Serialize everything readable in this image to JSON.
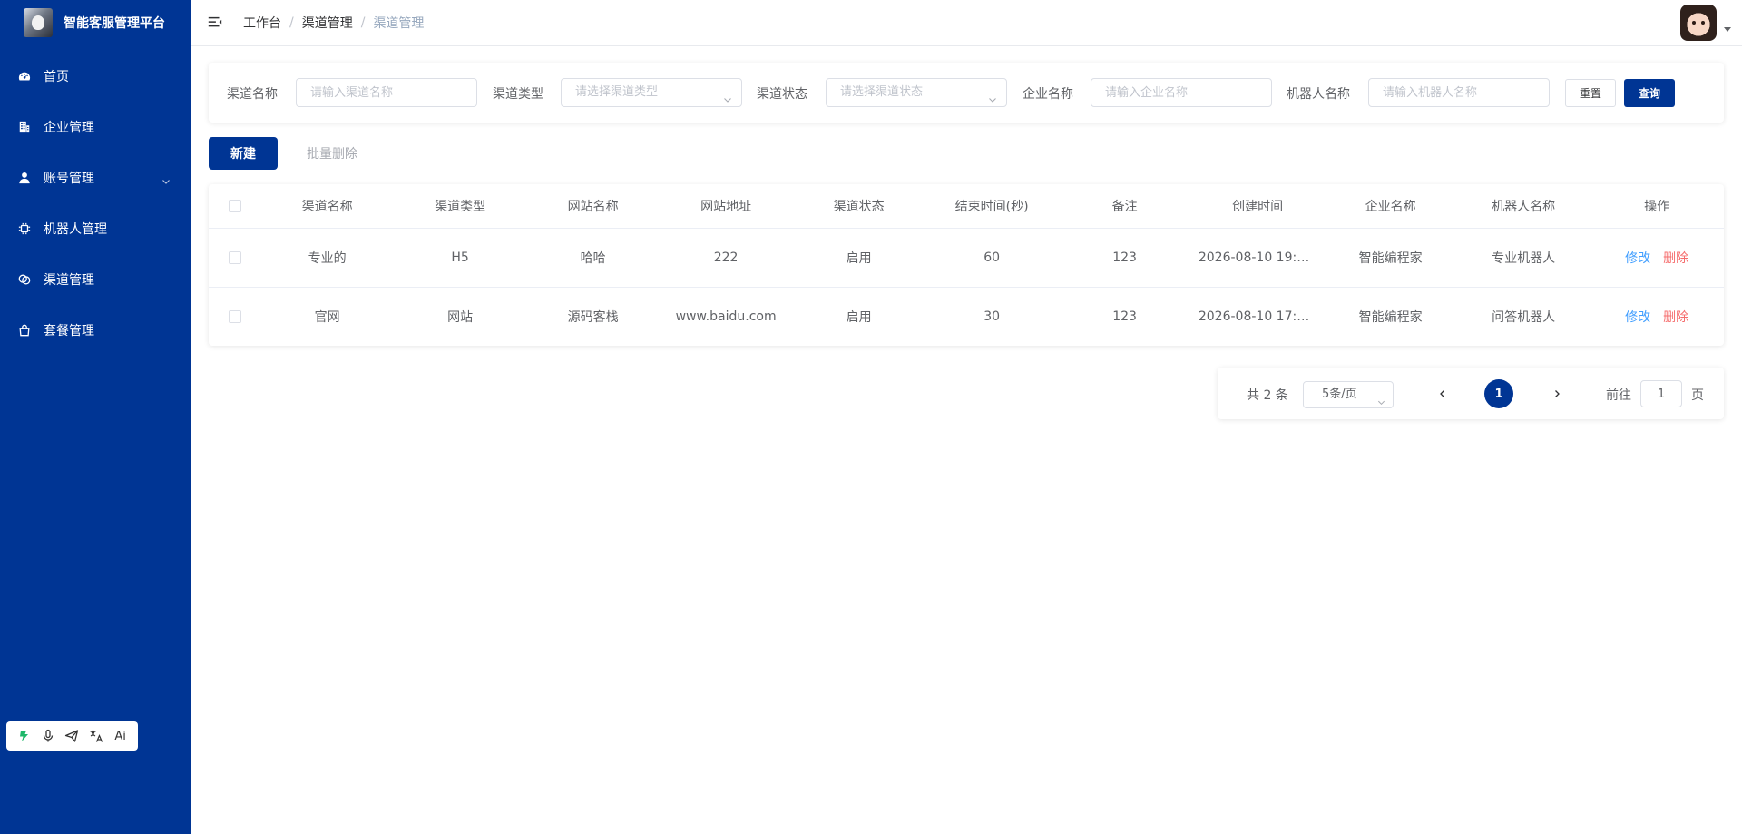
{
  "sidebar": {
    "brand_title": "智能客服管理平台",
    "items": [
      {
        "label": "首页",
        "icon": "dashboard-icon"
      },
      {
        "label": "企业管理",
        "icon": "building-icon"
      },
      {
        "label": "账号管理",
        "icon": "user-icon",
        "has_children": true
      },
      {
        "label": "机器人管理",
        "icon": "chip-icon"
      },
      {
        "label": "渠道管理",
        "icon": "channel-icon"
      },
      {
        "label": "套餐管理",
        "icon": "bag-icon"
      }
    ],
    "tools": [
      "plugin-icon",
      "microphone-icon",
      "send-icon",
      "translate-icon",
      "ai-icon"
    ],
    "ai_label": "Ai"
  },
  "header": {
    "breadcrumb": [
      "工作台",
      "渠道管理",
      "渠道管理"
    ],
    "breadcrumb_sep": "/"
  },
  "search": {
    "channel_name_label": "渠道名称",
    "channel_name_placeholder": "请输入渠道名称",
    "channel_type_label": "渠道类型",
    "channel_type_placeholder": "请选择渠道类型",
    "channel_status_label": "渠道状态",
    "channel_status_placeholder": "请选择渠道状态",
    "company_label": "企业名称",
    "company_placeholder": "请输入企业名称",
    "robot_label": "机器人名称",
    "robot_placeholder": "请输入机器人名称",
    "reset_label": "重置",
    "query_label": "查询"
  },
  "actions": {
    "new_label": "新建",
    "batch_delete_label": "批量删除"
  },
  "table": {
    "columns": [
      "渠道名称",
      "渠道类型",
      "网站名称",
      "网站地址",
      "渠道状态",
      "结束时间(秒)",
      "备注",
      "创建时间",
      "企业名称",
      "机器人名称",
      "操作"
    ],
    "rows": [
      {
        "channel_name": "专业的",
        "channel_type": "H5",
        "site_name": "哈哈",
        "site_url": "222",
        "status": "启用",
        "end_time": "60",
        "remark": "123",
        "created_at": "2026-08-10 19:5...",
        "company": "智能编程家",
        "robot": "专业机器人"
      },
      {
        "channel_name": "官网",
        "channel_type": "网站",
        "site_name": "源码客栈",
        "site_url": "www.baidu.com",
        "status": "启用",
        "end_time": "30",
        "remark": "123",
        "created_at": "2026-08-10 17:0...",
        "company": "智能编程家",
        "robot": "问答机器人"
      }
    ],
    "edit_label": "修改",
    "delete_label": "删除"
  },
  "pagination": {
    "total_text": "共 2 条",
    "page_size": "5条/页",
    "current_page": "1",
    "goto_label": "前往",
    "jump_value": "1",
    "page_suffix": "页"
  },
  "colors": {
    "primary": "#003594",
    "link": "#409eff",
    "danger": "#f56c6c"
  }
}
